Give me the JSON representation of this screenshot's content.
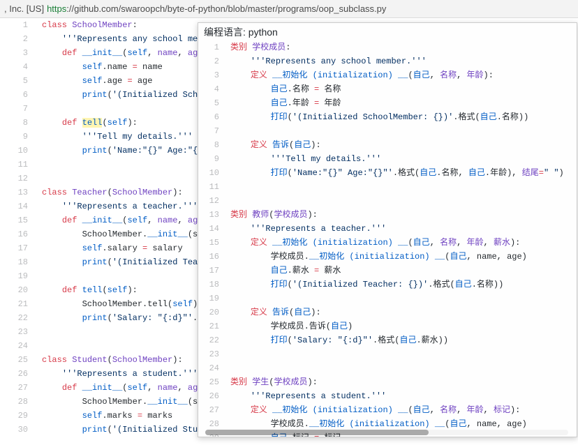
{
  "url": {
    "prefix": ", Inc. [US]",
    "https": "https",
    "rest": "://github.com/swaroopch/byte-of-python/blob/master/programs/oop_subclass.py"
  },
  "programming_language_label": "编程语言: python",
  "left_code": [
    {
      "n": 1,
      "segs": [
        [
          "k",
          "class"
        ],
        [
          "n",
          " "
        ],
        [
          "nc",
          "SchoolMember"
        ],
        [
          "n",
          ":"
        ]
      ]
    },
    {
      "n": 2,
      "segs": [
        [
          "n",
          "    "
        ],
        [
          "s",
          "'''Represents any school memb"
        ]
      ]
    },
    {
      "n": 3,
      "segs": [
        [
          "n",
          "    "
        ],
        [
          "k",
          "def"
        ],
        [
          "n",
          " "
        ],
        [
          "nf",
          "__init__"
        ],
        [
          "n",
          "("
        ],
        [
          "bp",
          "self"
        ],
        [
          "n",
          ", "
        ],
        [
          "np",
          "name"
        ],
        [
          "n",
          ", "
        ],
        [
          "np",
          "age"
        ],
        [
          "n",
          ")"
        ]
      ]
    },
    {
      "n": 4,
      "segs": [
        [
          "n",
          "        "
        ],
        [
          "bp",
          "self"
        ],
        [
          "n",
          "."
        ],
        [
          "n",
          "name "
        ],
        [
          "k",
          "="
        ],
        [
          "n",
          " name"
        ]
      ]
    },
    {
      "n": 5,
      "segs": [
        [
          "n",
          "        "
        ],
        [
          "bp",
          "self"
        ],
        [
          "n",
          "."
        ],
        [
          "n",
          "age "
        ],
        [
          "k",
          "="
        ],
        [
          "n",
          " age"
        ]
      ]
    },
    {
      "n": 6,
      "segs": [
        [
          "n",
          "        "
        ],
        [
          "nf",
          "print"
        ],
        [
          "n",
          "("
        ],
        [
          "s",
          "'(Initialized Schoo"
        ]
      ]
    },
    {
      "n": 7,
      "segs": []
    },
    {
      "n": 8,
      "segs": [
        [
          "n",
          "    "
        ],
        [
          "k",
          "def"
        ],
        [
          "n",
          " "
        ],
        [
          "nf hl",
          "tell"
        ],
        [
          "n",
          "("
        ],
        [
          "bp",
          "self"
        ],
        [
          "n",
          "):"
        ]
      ]
    },
    {
      "n": 9,
      "segs": [
        [
          "n",
          "        "
        ],
        [
          "s",
          "'''Tell my details.'''"
        ]
      ]
    },
    {
      "n": 10,
      "segs": [
        [
          "n",
          "        "
        ],
        [
          "nf",
          "print"
        ],
        [
          "n",
          "("
        ],
        [
          "s",
          "'Name:\"{}\" Age:\"{}\""
        ]
      ]
    },
    {
      "n": 11,
      "segs": []
    },
    {
      "n": 12,
      "segs": []
    },
    {
      "n": 13,
      "segs": [
        [
          "k",
          "class"
        ],
        [
          "n",
          " "
        ],
        [
          "nc",
          "Teacher"
        ],
        [
          "n",
          "("
        ],
        [
          "nc",
          "SchoolMember"
        ],
        [
          "n",
          "):"
        ]
      ]
    },
    {
      "n": 14,
      "segs": [
        [
          "n",
          "    "
        ],
        [
          "s",
          "'''Represents a teacher.'''"
        ]
      ]
    },
    {
      "n": 15,
      "segs": [
        [
          "n",
          "    "
        ],
        [
          "k",
          "def"
        ],
        [
          "n",
          " "
        ],
        [
          "nf",
          "__init__"
        ],
        [
          "n",
          "("
        ],
        [
          "bp",
          "self"
        ],
        [
          "n",
          ", "
        ],
        [
          "np",
          "name"
        ],
        [
          "n",
          ", "
        ],
        [
          "np",
          "age"
        ],
        [
          "n",
          ","
        ]
      ]
    },
    {
      "n": 16,
      "segs": [
        [
          "n",
          "        SchoolMember."
        ],
        [
          "nf",
          "__init__"
        ],
        [
          "n",
          "(se"
        ]
      ]
    },
    {
      "n": 17,
      "segs": [
        [
          "n",
          "        "
        ],
        [
          "bp",
          "self"
        ],
        [
          "n",
          ".salary "
        ],
        [
          "k",
          "="
        ],
        [
          "n",
          " salary"
        ]
      ]
    },
    {
      "n": 18,
      "segs": [
        [
          "n",
          "        "
        ],
        [
          "nf",
          "print"
        ],
        [
          "n",
          "("
        ],
        [
          "s",
          "'(Initialized Teach"
        ]
      ]
    },
    {
      "n": 19,
      "segs": []
    },
    {
      "n": 20,
      "segs": [
        [
          "n",
          "    "
        ],
        [
          "k",
          "def"
        ],
        [
          "n",
          " "
        ],
        [
          "nf",
          "tell"
        ],
        [
          "n",
          "("
        ],
        [
          "bp",
          "self"
        ],
        [
          "n",
          "):"
        ]
      ]
    },
    {
      "n": 21,
      "segs": [
        [
          "n",
          "        SchoolMember.tell("
        ],
        [
          "bp",
          "self"
        ],
        [
          "n",
          ")"
        ]
      ]
    },
    {
      "n": 22,
      "segs": [
        [
          "n",
          "        "
        ],
        [
          "nf",
          "print"
        ],
        [
          "n",
          "("
        ],
        [
          "s",
          "'Salary: \"{:d}\"'"
        ],
        [
          "n",
          ".fo"
        ]
      ]
    },
    {
      "n": 23,
      "segs": []
    },
    {
      "n": 24,
      "segs": []
    },
    {
      "n": 25,
      "segs": [
        [
          "k",
          "class"
        ],
        [
          "n",
          " "
        ],
        [
          "nc",
          "Student"
        ],
        [
          "n",
          "("
        ],
        [
          "nc",
          "SchoolMember"
        ],
        [
          "n",
          "):"
        ]
      ]
    },
    {
      "n": 26,
      "segs": [
        [
          "n",
          "    "
        ],
        [
          "s",
          "'''Represents a student.'''"
        ]
      ]
    },
    {
      "n": 27,
      "segs": [
        [
          "n",
          "    "
        ],
        [
          "k",
          "def"
        ],
        [
          "n",
          " "
        ],
        [
          "nf",
          "__init__"
        ],
        [
          "n",
          "("
        ],
        [
          "bp",
          "self"
        ],
        [
          "n",
          ", "
        ],
        [
          "np",
          "name"
        ],
        [
          "n",
          ", "
        ],
        [
          "np",
          "age"
        ],
        [
          "n",
          ","
        ]
      ]
    },
    {
      "n": 28,
      "segs": [
        [
          "n",
          "        SchoolMember."
        ],
        [
          "nf",
          "__init__"
        ],
        [
          "n",
          "(se"
        ]
      ]
    },
    {
      "n": 29,
      "segs": [
        [
          "n",
          "        "
        ],
        [
          "bp",
          "self"
        ],
        [
          "n",
          ".marks "
        ],
        [
          "k",
          "="
        ],
        [
          "n",
          " marks"
        ]
      ]
    },
    {
      "n": 30,
      "segs": [
        [
          "n",
          "        "
        ],
        [
          "nf",
          "print"
        ],
        [
          "n",
          "("
        ],
        [
          "s",
          "'(Initialized Stude"
        ]
      ]
    }
  ],
  "right_code": [
    {
      "n": 1,
      "segs": [
        [
          "k",
          "类别"
        ],
        [
          "n",
          " "
        ],
        [
          "nc",
          "学校成员"
        ],
        [
          "n",
          ":"
        ]
      ]
    },
    {
      "n": 2,
      "segs": [
        [
          "n",
          "    "
        ],
        [
          "s",
          "'''Represents any school member.'''"
        ]
      ]
    },
    {
      "n": 3,
      "segs": [
        [
          "n",
          "    "
        ],
        [
          "k",
          "定义"
        ],
        [
          "n",
          " "
        ],
        [
          "nf",
          "__初始化 (initialization) __"
        ],
        [
          "n",
          "("
        ],
        [
          "bp",
          "自己"
        ],
        [
          "n",
          ", "
        ],
        [
          "np",
          "名称"
        ],
        [
          "n",
          ", "
        ],
        [
          "np",
          "年龄"
        ],
        [
          "n",
          "):"
        ]
      ]
    },
    {
      "n": 4,
      "segs": [
        [
          "n",
          "        "
        ],
        [
          "bp",
          "自己"
        ],
        [
          "n",
          "."
        ],
        [
          "n",
          "名称 "
        ],
        [
          "k",
          "="
        ],
        [
          "n",
          " 名称"
        ]
      ]
    },
    {
      "n": 5,
      "segs": [
        [
          "n",
          "        "
        ],
        [
          "bp",
          "自己"
        ],
        [
          "n",
          "."
        ],
        [
          "n",
          "年龄 "
        ],
        [
          "k",
          "="
        ],
        [
          "n",
          " 年龄"
        ]
      ]
    },
    {
      "n": 6,
      "segs": [
        [
          "n",
          "        "
        ],
        [
          "nf",
          "打印"
        ],
        [
          "n",
          "("
        ],
        [
          "s",
          "'(Initialized SchoolMember: {})'"
        ],
        [
          "n",
          ".格式("
        ],
        [
          "bp",
          "自己"
        ],
        [
          "n",
          ".名称))"
        ]
      ]
    },
    {
      "n": 7,
      "segs": []
    },
    {
      "n": 8,
      "segs": [
        [
          "n",
          "    "
        ],
        [
          "k",
          "定义"
        ],
        [
          "n",
          " "
        ],
        [
          "nf",
          "告诉"
        ],
        [
          "n",
          "("
        ],
        [
          "bp",
          "自己"
        ],
        [
          "n",
          "):"
        ]
      ]
    },
    {
      "n": 9,
      "segs": [
        [
          "n",
          "        "
        ],
        [
          "s",
          "'''Tell my details.'''"
        ]
      ]
    },
    {
      "n": 10,
      "segs": [
        [
          "n",
          "        "
        ],
        [
          "nf",
          "打印"
        ],
        [
          "n",
          "("
        ],
        [
          "s",
          "'Name:\"{}\" Age:\"{}\"'"
        ],
        [
          "n",
          ".格式("
        ],
        [
          "bp",
          "自己"
        ],
        [
          "n",
          ".名称, "
        ],
        [
          "bp",
          "自己"
        ],
        [
          "n",
          ".年龄), "
        ],
        [
          "np",
          "结尾"
        ],
        [
          "k",
          "="
        ],
        [
          "s",
          "\" \""
        ],
        [
          "n",
          ")"
        ]
      ]
    },
    {
      "n": 11,
      "segs": []
    },
    {
      "n": 12,
      "segs": []
    },
    {
      "n": 13,
      "segs": [
        [
          "k",
          "类别"
        ],
        [
          "n",
          " "
        ],
        [
          "nc",
          "教师"
        ],
        [
          "n",
          "("
        ],
        [
          "nc",
          "学校成员"
        ],
        [
          "n",
          "):"
        ]
      ]
    },
    {
      "n": 14,
      "segs": [
        [
          "n",
          "    "
        ],
        [
          "s",
          "'''Represents a teacher.'''"
        ]
      ]
    },
    {
      "n": 15,
      "segs": [
        [
          "n",
          "    "
        ],
        [
          "k",
          "定义"
        ],
        [
          "n",
          " "
        ],
        [
          "nf",
          "__初始化 (initialization) __"
        ],
        [
          "n",
          "("
        ],
        [
          "bp",
          "自己"
        ],
        [
          "n",
          ", "
        ],
        [
          "np",
          "名称"
        ],
        [
          "n",
          ", "
        ],
        [
          "np",
          "年龄"
        ],
        [
          "n",
          ", "
        ],
        [
          "np",
          "薪水"
        ],
        [
          "n",
          "):"
        ]
      ]
    },
    {
      "n": 16,
      "segs": [
        [
          "n",
          "        学校成员."
        ],
        [
          "nf",
          "__初始化 (initialization) __"
        ],
        [
          "n",
          "("
        ],
        [
          "bp",
          "自己"
        ],
        [
          "n",
          ", name, age)"
        ]
      ]
    },
    {
      "n": 17,
      "segs": [
        [
          "n",
          "        "
        ],
        [
          "bp",
          "自己"
        ],
        [
          "n",
          ".薪水 "
        ],
        [
          "k",
          "="
        ],
        [
          "n",
          " 薪水"
        ]
      ]
    },
    {
      "n": 18,
      "segs": [
        [
          "n",
          "        "
        ],
        [
          "nf",
          "打印"
        ],
        [
          "n",
          "("
        ],
        [
          "s",
          "'(Initialized Teacher: {})'"
        ],
        [
          "n",
          ".格式("
        ],
        [
          "bp",
          "自己"
        ],
        [
          "n",
          ".名称))"
        ]
      ]
    },
    {
      "n": 19,
      "segs": []
    },
    {
      "n": 20,
      "segs": [
        [
          "n",
          "    "
        ],
        [
          "k",
          "定义"
        ],
        [
          "n",
          " "
        ],
        [
          "nf",
          "告诉"
        ],
        [
          "n",
          "("
        ],
        [
          "bp",
          "自己"
        ],
        [
          "n",
          "):"
        ]
      ]
    },
    {
      "n": 21,
      "segs": [
        [
          "n",
          "        学校成员.告诉("
        ],
        [
          "bp",
          "自己"
        ],
        [
          "n",
          ")"
        ]
      ]
    },
    {
      "n": 22,
      "segs": [
        [
          "n",
          "        "
        ],
        [
          "nf",
          "打印"
        ],
        [
          "n",
          "("
        ],
        [
          "s",
          "'Salary: \"{:d}\"'"
        ],
        [
          "n",
          ".格式("
        ],
        [
          "bp",
          "自己"
        ],
        [
          "n",
          ".薪水))"
        ]
      ]
    },
    {
      "n": 23,
      "segs": []
    },
    {
      "n": 24,
      "segs": []
    },
    {
      "n": 25,
      "segs": [
        [
          "k",
          "类别"
        ],
        [
          "n",
          " "
        ],
        [
          "nc",
          "学生"
        ],
        [
          "n",
          "("
        ],
        [
          "nc",
          "学校成员"
        ],
        [
          "n",
          "):"
        ]
      ]
    },
    {
      "n": 26,
      "segs": [
        [
          "n",
          "    "
        ],
        [
          "s",
          "'''Represents a student.'''"
        ]
      ]
    },
    {
      "n": 27,
      "segs": [
        [
          "n",
          "    "
        ],
        [
          "k",
          "定义"
        ],
        [
          "n",
          " "
        ],
        [
          "nf",
          "__初始化 (initialization) __"
        ],
        [
          "n",
          "("
        ],
        [
          "bp",
          "自己"
        ],
        [
          "n",
          ", "
        ],
        [
          "np",
          "名称"
        ],
        [
          "n",
          ", "
        ],
        [
          "np",
          "年龄"
        ],
        [
          "n",
          ", "
        ],
        [
          "np",
          "标记"
        ],
        [
          "n",
          "):"
        ]
      ]
    },
    {
      "n": 28,
      "segs": [
        [
          "n",
          "        学校成员."
        ],
        [
          "nf",
          "__初始化 (initialization) __"
        ],
        [
          "n",
          "("
        ],
        [
          "bp",
          "自己"
        ],
        [
          "n",
          ", name, age)"
        ]
      ]
    },
    {
      "n": 29,
      "segs": [
        [
          "n",
          "        "
        ],
        [
          "bp",
          "自己"
        ],
        [
          "n",
          ".标记 "
        ],
        [
          "k",
          "="
        ],
        [
          "n",
          " 标记"
        ]
      ]
    }
  ]
}
